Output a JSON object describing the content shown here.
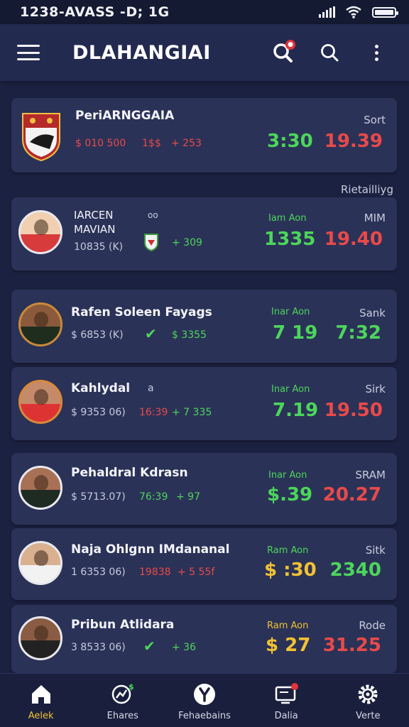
{
  "status": {
    "time": "1238-AVASS -D; 1G"
  },
  "appbar": {
    "title": "DLAHANGIAI"
  },
  "section_label": "Rietailliyg",
  "cards": [
    {
      "name": "PeriARNGGAIA",
      "stat_a": "$ 010 500",
      "stat_b": "1$$",
      "stat_c": "+ 253",
      "col1_value": "3:30",
      "col2_label": "Sort",
      "col2_value": "19.39"
    },
    {
      "name_line1": "IARCEN",
      "name_line2": "MAVIAN",
      "mini_value": "oo",
      "sub": "10835 (K)",
      "stat_c": "+ 309",
      "col1_label": "Iam Aon",
      "col1_value": "1335",
      "col2_label": "MIM",
      "col2_value": "19.40"
    },
    {
      "name": "Rafen Soleen Fayags",
      "sub": "$ 6853 (K)",
      "stat_c": "$ 3355",
      "col1_label": "Inar Aon",
      "col1_value": "7 19",
      "col2_label": "Sank",
      "col2_value": "7:32"
    },
    {
      "name": "Kahlydal",
      "mini_value": "a",
      "sub": "$ 9353 06)",
      "stat_b": "16:39",
      "stat_c": "+ 7 335",
      "col1_label": "Inar Aon",
      "col1_value": "7.19",
      "col2_label": "Sirk",
      "col2_value": "19.50"
    },
    {
      "name": "Pehaldral Kdrasn",
      "sub": "$ 5713.07)",
      "stat_b": "76:39",
      "stat_c": "+ 97",
      "col1_label": "Inar Aon",
      "col1_value": "$.39",
      "col2_label": "SRAM",
      "col2_value": "20.27"
    },
    {
      "name": "Naja Ohlgnn IMdananal",
      "sub": "1 6353 06)",
      "stat_b": "19838",
      "stat_c": "+ 5 55f",
      "col1_label": "Ram Aon",
      "col1_value": "$ :30",
      "col2_label": "Sitk",
      "col2_value": "2340"
    },
    {
      "name": "Pribun Atlidara",
      "sub": "3 8533 06)",
      "stat_c": "+ 36",
      "col1_label": "Ram Aon",
      "col1_value": "$ 27",
      "col2_label": "Rode",
      "col2_value": "31.25"
    }
  ],
  "nav": [
    {
      "label": "Aelek",
      "icon": "home-icon"
    },
    {
      "label": "Ehares",
      "icon": "chart-icon"
    },
    {
      "label": "Fehaebains",
      "icon": "trophy-icon"
    },
    {
      "label": "Dalia",
      "icon": "tv-icon"
    },
    {
      "label": "Verte",
      "icon": "gear-icon"
    }
  ],
  "colors": {
    "accent": "#f1c232",
    "red": "#e84a4a",
    "green": "#4cd65a",
    "background": "#1b2140",
    "card": "#2b3257"
  }
}
